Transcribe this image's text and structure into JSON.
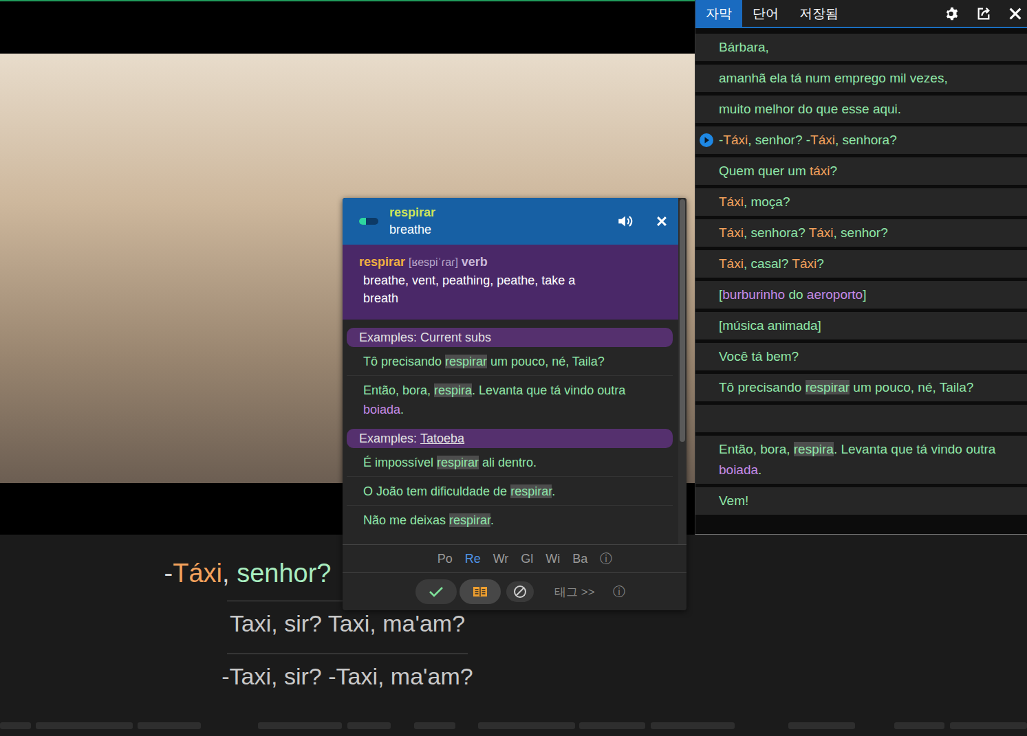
{
  "player": {
    "subtitle_tokens": [
      {
        "text": "-",
        "color": "#d6d6d6"
      },
      {
        "text": "Táxi",
        "color": "#f4a25c"
      },
      {
        "text": ", ",
        "color": "#d6d6d6"
      },
      {
        "text": "senhor?",
        "color": "#a8ecbf"
      }
    ],
    "translations": [
      "Taxi, sir? Taxi, ma'am?",
      "-Taxi, sir? -Taxi, ma'am?"
    ]
  },
  "panel": {
    "tabs": [
      {
        "label": "자막",
        "selected": true
      },
      {
        "label": "단어",
        "selected": false
      },
      {
        "label": "저장됨",
        "selected": false
      }
    ],
    "rows": [
      {
        "playing": false,
        "tokens": [
          {
            "text": "Bárbara,",
            "color": "#8fe6a8",
            "highlighted": false
          }
        ]
      },
      {
        "playing": false,
        "tokens": [
          {
            "text": "amanhã ela tá num emprego mil vezes,",
            "color": "#8fe6a8",
            "highlighted": false
          }
        ]
      },
      {
        "playing": false,
        "tokens": [
          {
            "text": "muito melhor do que esse aqui.",
            "color": "#8fe6a8",
            "highlighted": false
          }
        ]
      },
      {
        "playing": true,
        "tokens": [
          {
            "text": "-",
            "color": "#8fe6a8",
            "highlighted": false
          },
          {
            "text": "Táxi",
            "color": "#f4a25c",
            "highlighted": false
          },
          {
            "text": ", senhor? -",
            "color": "#8fe6a8",
            "highlighted": false
          },
          {
            "text": "Táxi",
            "color": "#f4a25c",
            "highlighted": false
          },
          {
            "text": ", senhora?",
            "color": "#8fe6a8",
            "highlighted": false
          }
        ]
      },
      {
        "playing": false,
        "tokens": [
          {
            "text": "Quem quer um ",
            "color": "#8fe6a8",
            "highlighted": false
          },
          {
            "text": "táxi",
            "color": "#f4a25c",
            "highlighted": false
          },
          {
            "text": "?",
            "color": "#8fe6a8",
            "highlighted": false
          }
        ]
      },
      {
        "playing": false,
        "tokens": [
          {
            "text": "Táxi",
            "color": "#f4a25c",
            "highlighted": false
          },
          {
            "text": ", moça?",
            "color": "#8fe6a8",
            "highlighted": false
          }
        ]
      },
      {
        "playing": false,
        "tokens": [
          {
            "text": "Táxi",
            "color": "#f4a25c",
            "highlighted": false
          },
          {
            "text": ", senhora? ",
            "color": "#8fe6a8",
            "highlighted": false
          },
          {
            "text": "Táxi",
            "color": "#f4a25c",
            "highlighted": false
          },
          {
            "text": ", senhor?",
            "color": "#8fe6a8",
            "highlighted": false
          }
        ]
      },
      {
        "playing": false,
        "tokens": [
          {
            "text": "Táxi",
            "color": "#f4a25c",
            "highlighted": false
          },
          {
            "text": ", casal? ",
            "color": "#8fe6a8",
            "highlighted": false
          },
          {
            "text": "Táxi",
            "color": "#f4a25c",
            "highlighted": false
          },
          {
            "text": "?",
            "color": "#8fe6a8",
            "highlighted": false
          }
        ]
      },
      {
        "playing": false,
        "tokens": [
          {
            "text": "[",
            "color": "#8fe6a8",
            "highlighted": false
          },
          {
            "text": "burburinho",
            "color": "#c58be8",
            "highlighted": false
          },
          {
            "text": " do ",
            "color": "#8fe6a8",
            "highlighted": false
          },
          {
            "text": "aeroporto",
            "color": "#c58be8",
            "highlighted": false
          },
          {
            "text": "]",
            "color": "#8fe6a8",
            "highlighted": false
          }
        ]
      },
      {
        "playing": false,
        "tokens": [
          {
            "text": "[música animada]",
            "color": "#8fe6a8",
            "highlighted": false
          }
        ]
      },
      {
        "playing": false,
        "tokens": [
          {
            "text": "Você tá bem?",
            "color": "#8fe6a8",
            "highlighted": false
          }
        ]
      },
      {
        "playing": false,
        "tokens": [
          {
            "text": "Tô precisando ",
            "color": "#8fe6a8",
            "highlighted": false
          },
          {
            "text": "respirar",
            "color": "#8fe6a8",
            "highlighted": true
          },
          {
            "text": " um pouco, né, Taila?",
            "color": "#8fe6a8",
            "highlighted": false
          }
        ]
      },
      {
        "playing": false,
        "tokens": []
      },
      {
        "playing": false,
        "tokens": [
          {
            "text": "Então, bora, ",
            "color": "#8fe6a8",
            "highlighted": false
          },
          {
            "text": "respira",
            "color": "#8fe6a8",
            "highlighted": true
          },
          {
            "text": ". Levanta que tá vindo outra ",
            "color": "#8fe6a8",
            "highlighted": false
          },
          {
            "text": "boiada",
            "color": "#c58be8",
            "highlighted": false
          },
          {
            "text": ".",
            "color": "#8fe6a8",
            "highlighted": false
          }
        ]
      },
      {
        "playing": false,
        "tokens": [
          {
            "text": "Vem!",
            "color": "#8fe6a8",
            "highlighted": false
          }
        ]
      }
    ]
  },
  "popup": {
    "word": "respirar",
    "translation": "breathe",
    "level": 0.35,
    "scrollbar": {
      "level": 0.7
    },
    "entry": {
      "lemma": "respirar",
      "ipa": "[ʁespiˈɾaɾ]",
      "pos": "verb",
      "definition": "breathe, vent, peathing, peathe, take a breath"
    },
    "sections": [
      {
        "label": "Examples:",
        "source": "Current subs",
        "linked": false,
        "examples": [
          [
            {
              "text": "Tô precisando ",
              "color": "#8fe6a8",
              "highlighted": false
            },
            {
              "text": "respirar",
              "color": "#8fe6a8",
              "highlighted": true
            },
            {
              "text": " um pouco, né, Taila?",
              "color": "#8fe6a8",
              "highlighted": false
            }
          ],
          [
            {
              "text": "Então, bora, ",
              "color": "#8fe6a8",
              "highlighted": false
            },
            {
              "text": "respira",
              "color": "#8fe6a8",
              "highlighted": true
            },
            {
              "text": ". Levanta que tá vindo outra ",
              "color": "#8fe6a8",
              "highlighted": false
            },
            {
              "text": "boiada",
              "color": "#c58be8",
              "highlighted": false
            },
            {
              "text": ".",
              "color": "#8fe6a8",
              "highlighted": false
            }
          ]
        ]
      },
      {
        "label": "Examples:",
        "source": "Tatoeba",
        "linked": true,
        "examples": [
          [
            {
              "text": "É impossível ",
              "color": "#8fe6a8",
              "highlighted": false
            },
            {
              "text": "respirar",
              "color": "#8fe6a8",
              "highlighted": true
            },
            {
              "text": " ali dentro.",
              "color": "#8fe6a8",
              "highlighted": false
            }
          ],
          [
            {
              "text": "O João tem dificuldade de ",
              "color": "#8fe6a8",
              "highlighted": false
            },
            {
              "text": "respirar",
              "color": "#8fe6a8",
              "highlighted": true
            },
            {
              "text": ".",
              "color": "#8fe6a8",
              "highlighted": false
            }
          ],
          [
            {
              "text": "Não me deixas ",
              "color": "#8fe6a8",
              "highlighted": false
            },
            {
              "text": "respirar",
              "color": "#8fe6a8",
              "highlighted": true
            },
            {
              "text": ".",
              "color": "#8fe6a8",
              "highlighted": false
            }
          ]
        ]
      }
    ],
    "dict_tabs": [
      {
        "label": "Po",
        "selected": false
      },
      {
        "label": "Re",
        "selected": true
      },
      {
        "label": "Wr",
        "selected": false
      },
      {
        "label": "Gl",
        "selected": false
      },
      {
        "label": "Wi",
        "selected": false
      },
      {
        "label": "Ba",
        "selected": false
      }
    ],
    "info_icon": "ⓘ",
    "actions": [
      {
        "kind": "check",
        "selected": false
      },
      {
        "kind": "book",
        "selected": true
      },
      {
        "kind": "ignore",
        "selected": false
      }
    ],
    "tag_label": "태그 >>"
  }
}
